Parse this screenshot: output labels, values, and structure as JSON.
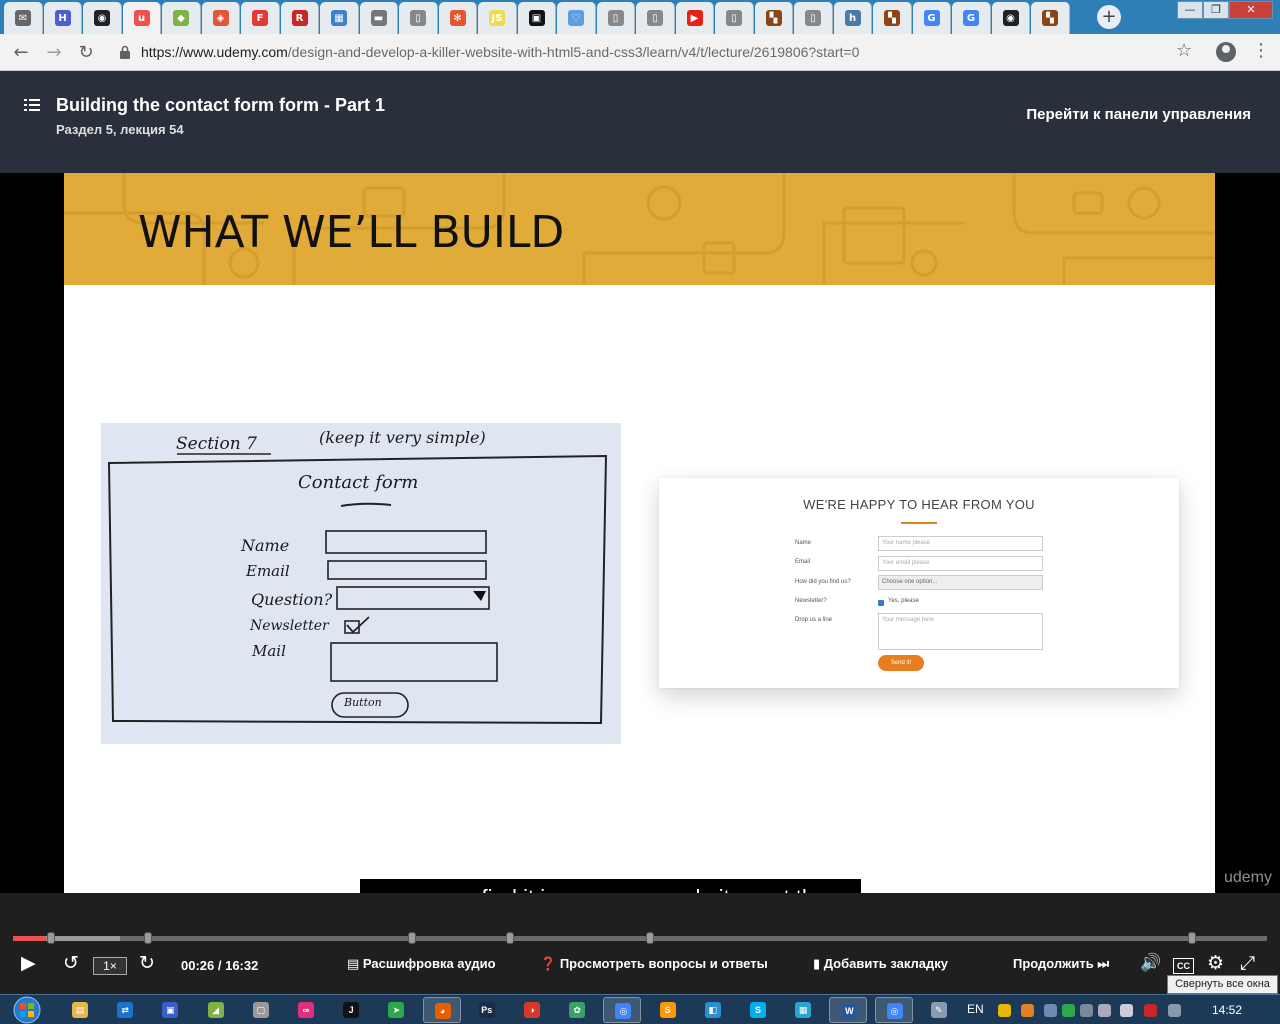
{
  "browser": {
    "tabs": [
      {
        "label": "",
        "color": "#666666",
        "glyph": "✉"
      },
      {
        "label": "",
        "color": "#4a5fd0",
        "glyph": "H"
      },
      {
        "label": "",
        "color": "#222222",
        "glyph": "◉"
      },
      {
        "label": "",
        "color": "#ec5252",
        "glyph": "u",
        "active": true
      },
      {
        "label": "",
        "color": "#7cb342",
        "glyph": "◆"
      },
      {
        "label": "",
        "color": "#e0563b",
        "glyph": "◈"
      },
      {
        "label": "",
        "color": "#e53935",
        "glyph": "F"
      },
      {
        "label": "",
        "color": "#c62828",
        "glyph": "R"
      },
      {
        "label": "",
        "color": "#3f7fd0",
        "glyph": "▦"
      },
      {
        "label": "",
        "color": "#777777",
        "glyph": "▬"
      },
      {
        "label": "",
        "color": "#888888",
        "glyph": "▯"
      },
      {
        "label": "",
        "color": "#e4572e",
        "glyph": "✻"
      },
      {
        "label": "",
        "color": "#f0db4f",
        "glyph": "JS"
      },
      {
        "label": "",
        "color": "#111111",
        "glyph": "▣"
      },
      {
        "label": "",
        "color": "#5aa0e0",
        "glyph": "♡"
      },
      {
        "label": "",
        "color": "#888888",
        "glyph": "▯"
      },
      {
        "label": "",
        "color": "#888888",
        "glyph": "▯"
      },
      {
        "label": "",
        "color": "#e62117",
        "glyph": "▶"
      },
      {
        "label": "",
        "color": "#888888",
        "glyph": "▯"
      },
      {
        "label": "",
        "color": "#8b4513",
        "glyph": "▚"
      },
      {
        "label": "",
        "color": "#888888",
        "glyph": "▯"
      },
      {
        "label": "",
        "color": "#4a7ba7",
        "glyph": "h"
      },
      {
        "label": "",
        "color": "#8b4513",
        "glyph": "▚"
      },
      {
        "label": "",
        "color": "#4285f4",
        "glyph": "G"
      },
      {
        "label": "",
        "color": "#4285f4",
        "glyph": "G"
      },
      {
        "label": "",
        "color": "#222222",
        "glyph": "◉"
      },
      {
        "label": "",
        "color": "#8b4513",
        "glyph": "▚"
      }
    ],
    "new_tab_glyph": "+",
    "window_controls": {
      "minimize": "—",
      "maximize": "❐",
      "close": "✕"
    },
    "url_host": "https://www.udemy.com",
    "url_path": "/design-and-develop-a-killer-website-with-html5-and-css3/learn/v4/t/lecture/2619806?start=0",
    "nav": {
      "back": "←",
      "forward": "→",
      "reload": "↻",
      "bookmark": "☆",
      "menu": "⋮"
    }
  },
  "header": {
    "lecture_title": "Building the contact form form - Part 1",
    "section": "Раздел 5, лекция 54",
    "dashboard_link": "Перейти к панели управления"
  },
  "slide": {
    "banner_title": "WHAT WE’LL BUILD",
    "sketch": {
      "section": "Section 7",
      "note": "(keep it very simple)",
      "heading": "Contact form",
      "fields": [
        "Name",
        "Email",
        "Question?",
        "Newsletter",
        "Mail"
      ],
      "button": "Button"
    },
    "form": {
      "title": "WE'RE HAPPY TO HEAR FROM YOU",
      "labels": [
        "Name",
        "Email",
        "How did you find us?",
        "Newsletter?",
        "Drop us a line"
      ],
      "placeholders": [
        "Your name please",
        "Your email please",
        "Choose one option...",
        "Your message here"
      ],
      "checkbox_label": "Yes, please",
      "button": "Send it!"
    },
    "watermark": "udemy"
  },
  "caption": "as you can find it in numerous websites out there.",
  "player": {
    "progress_fraction": 0.0265,
    "buffer_fraction": 0.085,
    "chapter_marks": [
      0.03,
      0.108,
      0.318,
      0.396,
      0.508,
      0.94
    ],
    "speed": "1×",
    "time": "00:26 / 16:32",
    "transcript": "Расшифровка аудио",
    "qa": "Просмотреть вопросы и ответы",
    "bookmark": "Добавить закладку",
    "continue": "Продолжить",
    "cc": "CC",
    "tooltip": "Свернуть все окна",
    "icons": {
      "play": "▶",
      "rewind": "↺",
      "forward": "↻",
      "volume": "🔊",
      "settings": "⚙",
      "fullscreen": "⤢"
    }
  },
  "taskbar": {
    "apps": [
      {
        "name": "explorer",
        "color": "#e8b54a",
        "glyph": "▤"
      },
      {
        "name": "teamviewer",
        "color": "#1a73c8",
        "glyph": "⇄"
      },
      {
        "name": "save",
        "color": "#3a5fc8",
        "glyph": "▣"
      },
      {
        "name": "android",
        "color": "#7cb342",
        "glyph": "◢"
      },
      {
        "name": "box",
        "color": "#999999",
        "glyph": "▢"
      },
      {
        "name": "flickr",
        "color": "#e0307a",
        "glyph": "∞"
      },
      {
        "name": "jetbrains",
        "color": "#111111",
        "glyph": "J"
      },
      {
        "name": "arrow",
        "color": "#2ea84a",
        "glyph": "➤"
      },
      {
        "name": "firefox",
        "color": "#e66000",
        "glyph": "◕",
        "active": true
      },
      {
        "name": "photoshop",
        "color": "#1a2a4a",
        "glyph": "Ps"
      },
      {
        "name": "color",
        "color": "#d33a2c",
        "glyph": "◑"
      },
      {
        "name": "settings",
        "color": "#3aa06a",
        "glyph": "✿"
      },
      {
        "name": "chrome",
        "color": "#4285f4",
        "glyph": "◎",
        "active": true
      },
      {
        "name": "sublime",
        "color": "#ff9800",
        "glyph": "S"
      },
      {
        "name": "vscode",
        "color": "#2a8fd0",
        "glyph": "◧"
      },
      {
        "name": "skype",
        "color": "#00aff0",
        "glyph": "S"
      },
      {
        "name": "calendar",
        "color": "#2aa5d0",
        "glyph": "▦"
      },
      {
        "name": "word",
        "color": "#2b579a",
        "glyph": "W",
        "active": true
      },
      {
        "name": "chrome2",
        "color": "#4285f4",
        "glyph": "◎",
        "active": true
      },
      {
        "name": "paint",
        "color": "#8a9ab0",
        "glyph": "✎"
      }
    ],
    "lang": "EN",
    "clock": "14:52"
  }
}
